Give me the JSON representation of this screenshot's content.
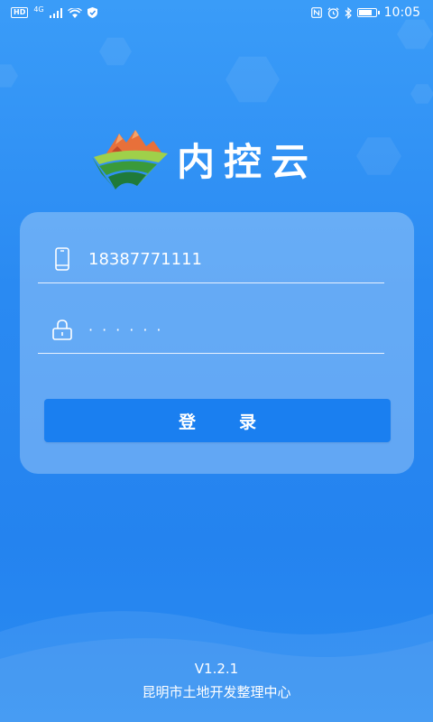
{
  "status_bar": {
    "hd_badge": "HD",
    "network": "4G",
    "time": "10:05",
    "battery_level": 0.85
  },
  "app": {
    "title": "内控云",
    "logo_icon": "farmland-mountain-logo"
  },
  "login": {
    "phone_icon": "phone-icon",
    "phone_value": "18387771111",
    "lock_icon": "lock-icon",
    "password_value": "······",
    "submit_label": "登录"
  },
  "footer": {
    "version": "V1.2.1",
    "organization": "昆明市土地开发整理中心"
  },
  "colors": {
    "background": "#2a8af2",
    "button": "#1a7ff0",
    "logo_green": "#3a9a3a",
    "logo_orange": "#e8703a"
  }
}
